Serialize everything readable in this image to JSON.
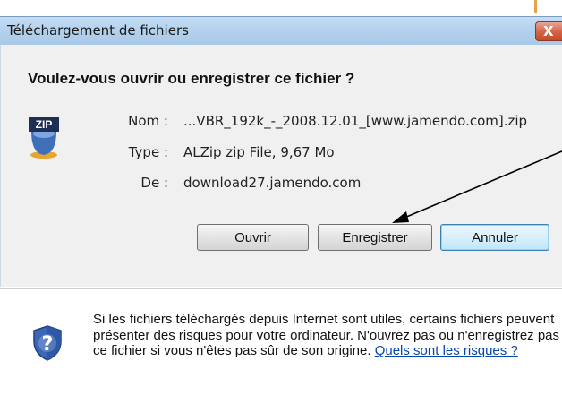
{
  "window": {
    "title": "Téléchargement de fichiers",
    "close_label": "X"
  },
  "question": "Voulez-vous ouvrir ou enregistrer ce fichier ?",
  "file": {
    "icon": "zip-icon",
    "icon_text": "ZIP",
    "fields": [
      {
        "label": "Nom :",
        "value": "...VBR_192k_-_2008.12.01_[www.jamendo.com].zip"
      },
      {
        "label": "Type :",
        "value": "ALZip zip File, 9,67 Mo"
      },
      {
        "label": "De :",
        "value": "download27.jamendo.com"
      }
    ]
  },
  "buttons": {
    "open": "Ouvrir",
    "save": "Enregistrer",
    "cancel": "Annuler"
  },
  "warning": {
    "icon": "shield-question-icon",
    "text": "Si les fichiers téléchargés depuis Internet sont utiles, certains fichiers peuvent présenter des risques pour votre ordinateur. N'ouvrez pas ou n'enregistrez pas ce fichier si vous n'êtes pas sûr de son origine. ",
    "link": "Quels sont les risques ?"
  },
  "colors": {
    "titlebar": "#b2d0ec",
    "close_button": "#d56548",
    "panel": "#f0f0f0",
    "link": "#0645ad",
    "arrow": "#000000"
  }
}
